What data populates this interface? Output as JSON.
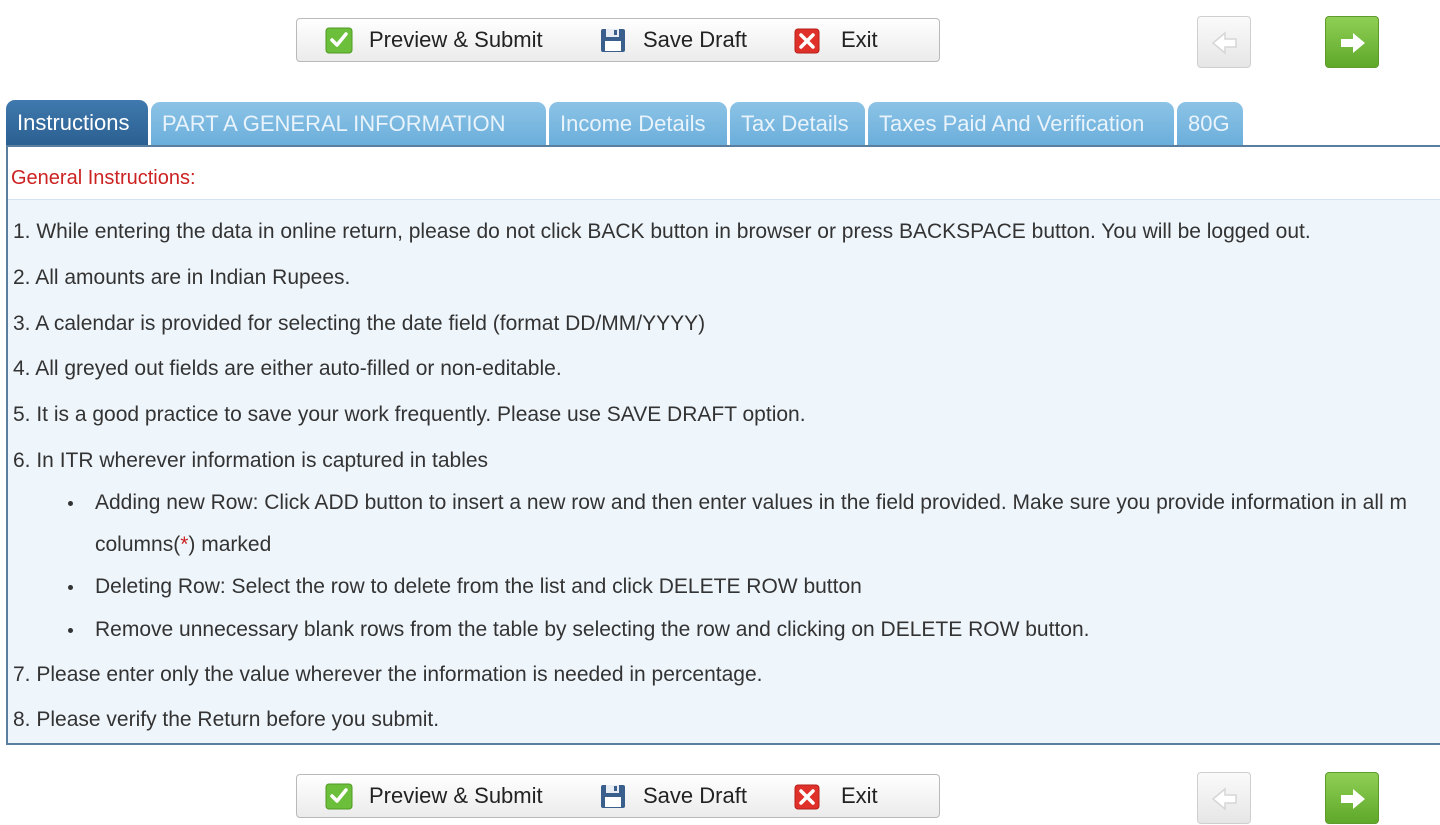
{
  "toolbar": {
    "preview_submit_label": "Preview & Submit",
    "save_draft_label": "Save Draft",
    "exit_label": "Exit"
  },
  "tabs": [
    {
      "label": "Instructions",
      "active": true
    },
    {
      "label": "PART A GENERAL INFORMATION",
      "active": false
    },
    {
      "label": "Income Details",
      "active": false
    },
    {
      "label": "Tax Details",
      "active": false
    },
    {
      "label": "Taxes Paid And Verification",
      "active": false
    },
    {
      "label": "80G",
      "active": false
    }
  ],
  "instructions": {
    "title": "General Instructions:",
    "items": [
      "1. While entering the data in online return, please do not click BACK button in browser or press BACKSPACE button. You will be logged out.",
      "2. All amounts are in Indian Rupees.",
      "3. A calendar is provided for selecting the date field (format DD/MM/YYYY)",
      "4. All greyed out fields are either auto-filled or non-editable.",
      "5. It is a good practice to save your work frequently. Please use SAVE DRAFT option.",
      "6. In ITR wherever information is captured in tables"
    ],
    "sub_items": [
      "Adding new Row: Click ADD button to insert a new row and then enter values in the field provided. Make sure you provide information in all m",
      "Deleting Row: Select the row to delete from the list and click DELETE ROW button",
      "Remove unnecessary blank rows from the table by selecting the row and clicking on DELETE ROW button."
    ],
    "sub_item_1_cont_prefix": "columns(",
    "sub_item_1_cont_star": "*",
    "sub_item_1_cont_suffix": ") marked",
    "items_after": [
      "7. Please enter only the value wherever the information is needed in percentage.",
      "8. Please verify the Return before you submit."
    ]
  },
  "colors": {
    "active_tab": "#2b5f91",
    "inactive_tab": "#6aaedb",
    "title_red": "#cc2222",
    "next_green": "#5ea82a"
  },
  "icons": {
    "preview": "green-check-icon",
    "save": "floppy-disk-icon",
    "exit": "red-x-icon",
    "prev": "left-arrow-icon",
    "next": "right-arrow-icon"
  }
}
